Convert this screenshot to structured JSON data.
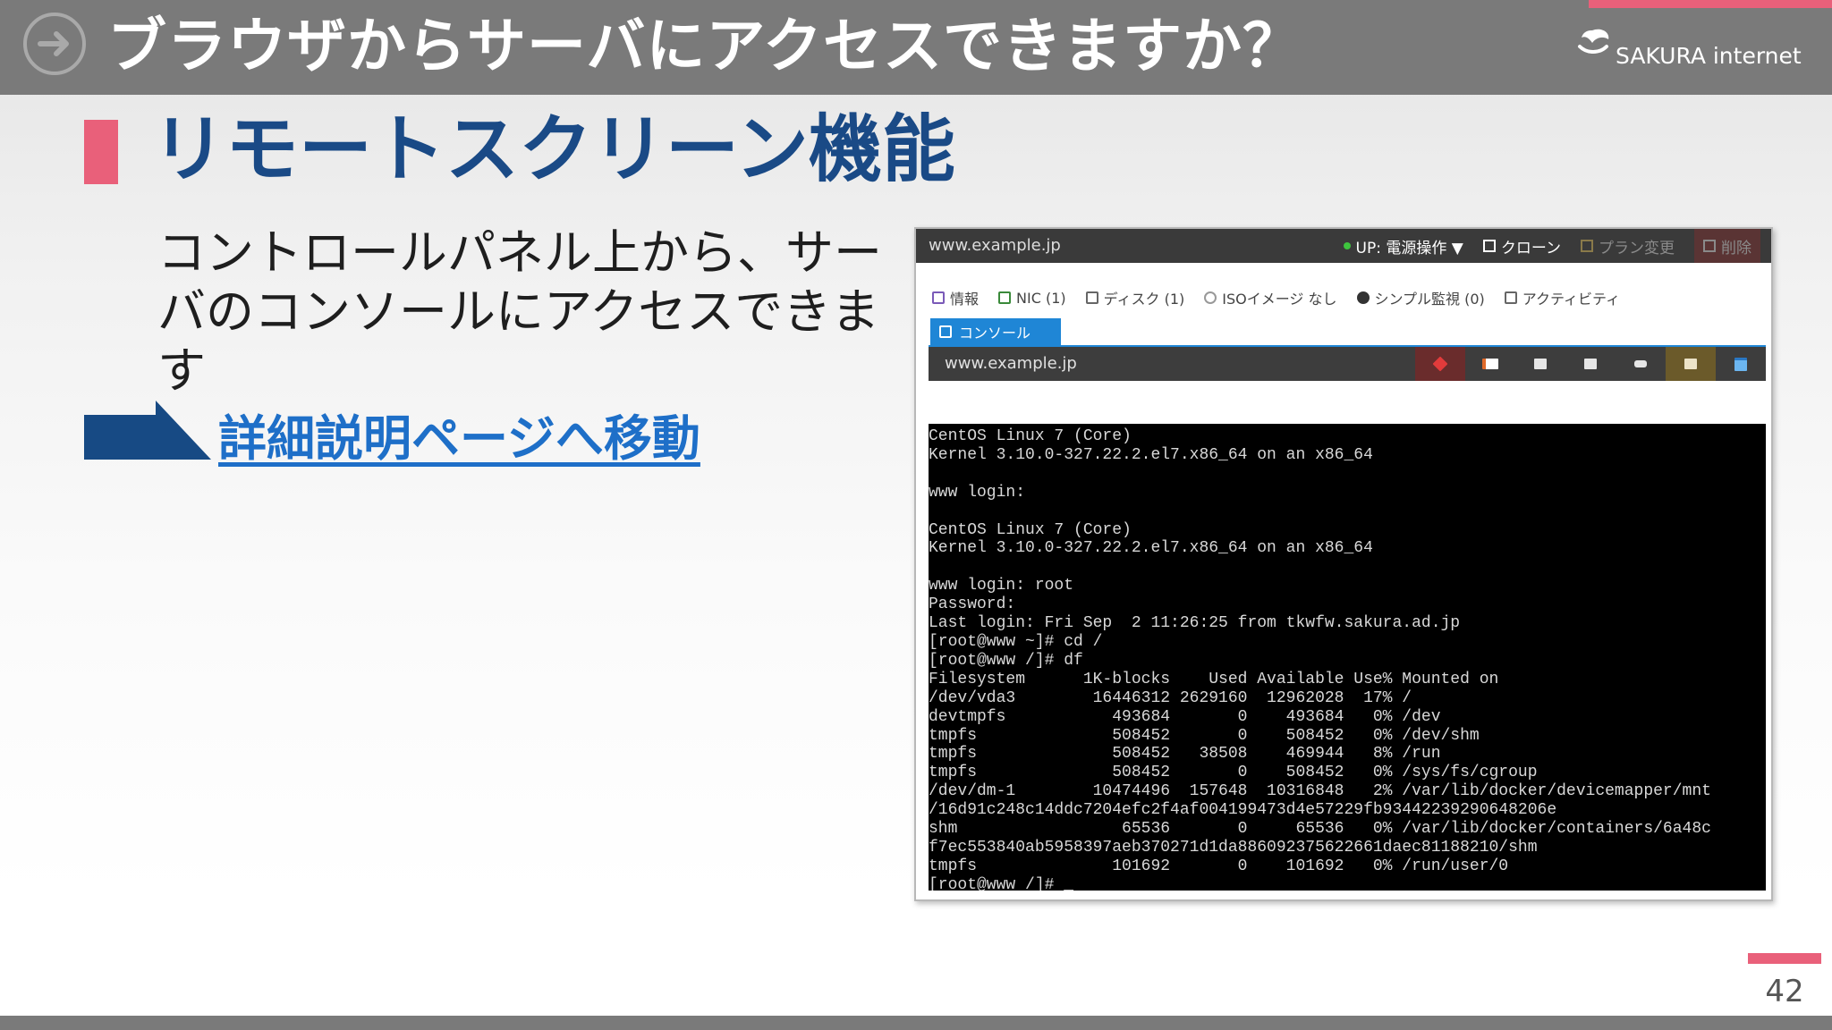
{
  "slide": {
    "title": "ブラウザからサーバにアクセスできますか？",
    "logo_text": "SAKURA internet",
    "section_title": "リモートスクリーン機能",
    "description": "コントロールパネル上から、サーバのコンソールにアクセスできます",
    "detail_link": "詳細説明ページへ移動",
    "page_number": "42"
  },
  "control_panel": {
    "hostname": "www.example.jp",
    "actions": [
      {
        "label": "UP: 電源操作 ▼",
        "icon": "power-status-icon"
      },
      {
        "label": "クローン",
        "icon": "clone-icon"
      },
      {
        "label": "プラン変更",
        "icon": "plan-change-icon"
      },
      {
        "label": "削除",
        "icon": "delete-icon"
      }
    ],
    "tabs": [
      {
        "label": "情報",
        "icon": "info-icon"
      },
      {
        "label": "NIC (1)",
        "icon": "nic-icon"
      },
      {
        "label": "ディスク (1)",
        "icon": "disk-icon"
      },
      {
        "label": "ISOイメージ なし",
        "icon": "iso-icon"
      },
      {
        "label": "シンプル監視 (0)",
        "icon": "monitor-icon"
      },
      {
        "label": "アクティビティ",
        "icon": "activity-icon"
      }
    ],
    "console_tab": "コンソール",
    "console_host": "www.example.jp",
    "console_tools": [
      "disconnect-icon",
      "clipboard-icon",
      "screen-icon",
      "screen-icon",
      "keyboard-icon",
      "screenshot-icon",
      "window-icon"
    ],
    "terminal": "CentOS Linux 7 (Core)\nKernel 3.10.0-327.22.2.el7.x86_64 on an x86_64\n\nwww login:\n\nCentOS Linux 7 (Core)\nKernel 3.10.0-327.22.2.el7.x86_64 on an x86_64\n\nwww login: root\nPassword:\nLast login: Fri Sep  2 11:26:25 from tkwfw.sakura.ad.jp\n[root@www ~]# cd /\n[root@www /]# df\nFilesystem      1K-blocks    Used Available Use% Mounted on\n/dev/vda3        16446312 2629160  12962028  17% /\ndevtmpfs           493684       0    493684   0% /dev\ntmpfs              508452       0    508452   0% /dev/shm\ntmpfs              508452   38508    469944   8% /run\ntmpfs              508452       0    508452   0% /sys/fs/cgroup\n/dev/dm-1        10474496  157648  10316848   2% /var/lib/docker/devicemapper/mnt\n/16d91c248c14ddc7204efc2f4af004199473d4e57229fb93442239290648206e\nshm                 65536       0     65536   0% /var/lib/docker/containers/6a48c\nf7ec553840ab5958397aeb370271d1da886092375622661daec81188210/shm\ntmpfs              101692       0    101692   0% /run/user/0\n[root@www /]# _"
  },
  "colors": {
    "header_bg": "#7a7a7a",
    "accent_pink": "#e9607a",
    "heading_navy": "#1a4a86",
    "link_blue": "#1e6fc8",
    "console_blue": "#1f86d6"
  }
}
